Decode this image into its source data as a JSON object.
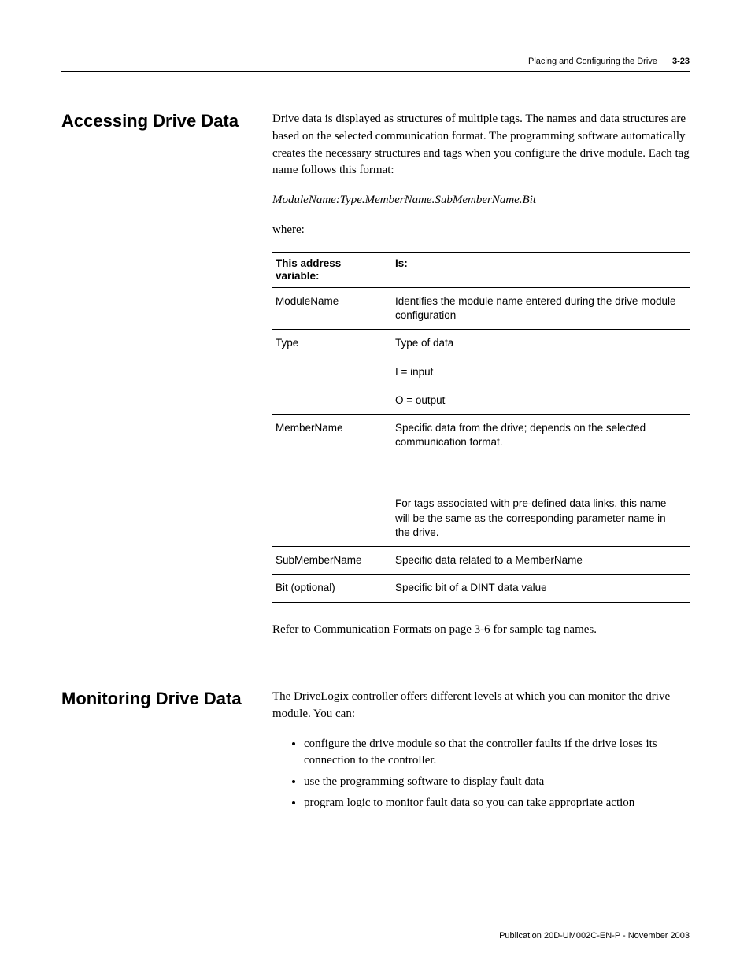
{
  "header": {
    "title": "Placing and Configuring the Drive",
    "page": "3-23"
  },
  "section1": {
    "heading": "Accessing Drive Data",
    "para1": "Drive data is displayed as structures of multiple tags. The names and data structures are based on the selected communication format. The programming software automatically creates the necessary structures and tags when you configure the drive module. Each tag name follows this format:",
    "format_line": "ModuleName:Type.MemberName.SubMemberName.Bit",
    "where": "where:",
    "table": {
      "col1_header": "This address variable:",
      "col2_header": "Is:",
      "rows": [
        {
          "var": "ModuleName",
          "desc": [
            "Identifies the module name entered during the drive module configuration"
          ]
        },
        {
          "var": "Type",
          "desc": [
            "Type of data",
            "I = input",
            "O = output"
          ]
        },
        {
          "var": "MemberName",
          "desc": [
            "Specific data from the drive; depends on the selected communication format.",
            "",
            "For tags associated with pre-defined data links, this name will be the same as the corresponding parameter name in the drive."
          ]
        },
        {
          "var": "SubMemberName",
          "desc": [
            "Specific data related to a MemberName"
          ]
        },
        {
          "var": "Bit (optional)",
          "desc": [
            "Specific bit of a DINT data value"
          ]
        }
      ]
    },
    "refer": "Refer to Communication Formats on page 3-6 for sample tag names."
  },
  "section2": {
    "heading": "Monitoring Drive Data",
    "para1": "The DriveLogix controller offers different levels at which you can monitor the drive module. You can:",
    "bullets": [
      "configure the drive module so that the controller faults if the drive loses its connection to the controller.",
      "use the programming software to display fault data",
      "program logic to monitor fault data so you can take appropriate action"
    ]
  },
  "footer": {
    "text": "Publication 20D-UM002C-EN-P - November 2003"
  }
}
